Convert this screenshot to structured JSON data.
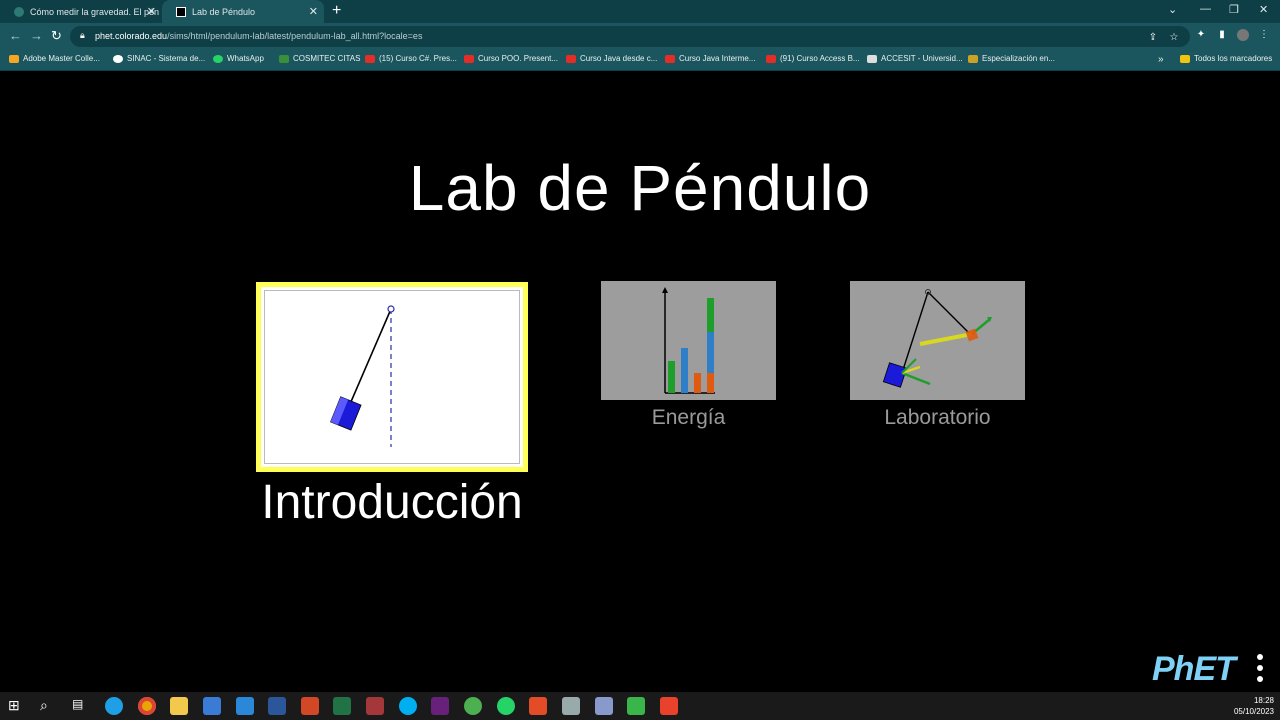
{
  "browser": {
    "tabs": [
      {
        "label": "Cómo medir la gravedad. El pén"
      },
      {
        "label": "Lab de Péndulo"
      }
    ],
    "url_host": "phet.colorado.edu",
    "url_path": "/sims/html/pendulum-lab/latest/pendulum-lab_all.html?locale=es",
    "bookmarks": [
      "Adobe Master Colle...",
      "SINAC - Sistema de...",
      "WhatsApp",
      "COSMITEC CITAS",
      "(15) Curso C#. Pres...",
      "Curso POO. Present...",
      "Curso Java desde c...",
      "Curso Java Interme...",
      "(91) Curso Access B...",
      "ACCESIT - Universid...",
      "Especialización en..."
    ],
    "all_bookmarks": "Todos los marcadores"
  },
  "sim": {
    "title": "Lab de Péndulo",
    "screens": [
      {
        "label": "Introducción",
        "selected": true
      },
      {
        "label": "Energía",
        "selected": false
      },
      {
        "label": "Laboratorio",
        "selected": false
      }
    ],
    "logo": "PhET"
  },
  "taskbar": {
    "time": "18:28",
    "date": "05/10/2023"
  },
  "colors": {
    "selected_border": "#ffff55",
    "chrome_frame": "#0e3f47",
    "chrome_toolbar": "#1b555d"
  }
}
